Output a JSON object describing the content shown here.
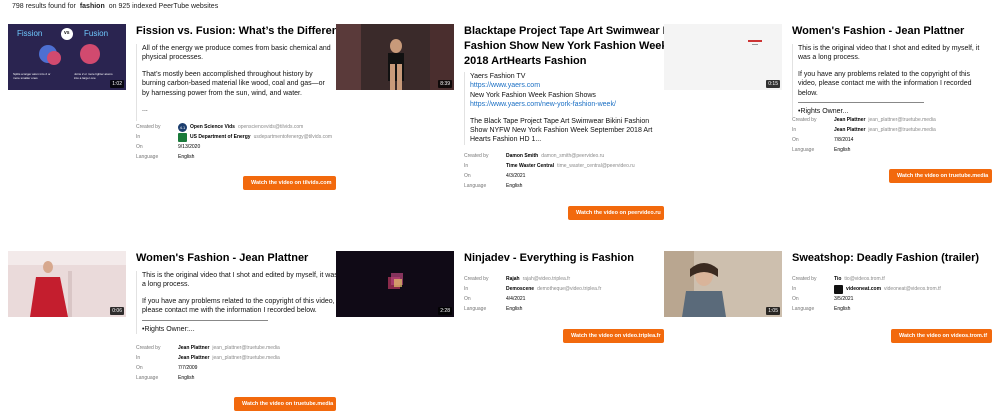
{
  "summary": {
    "count_text": "798 results found for",
    "query": "fashion",
    "indexed_text": "on 925 indexed PeerTube websites"
  },
  "labels": {
    "created_by": "Created by",
    "in": "In",
    "on": "On",
    "language": "Language"
  },
  "results": [
    {
      "title": "Fission vs. Fusion: What’s the Difference?",
      "duration": "1:02",
      "description": [
        "All of the energy we produce comes from basic chemical and physical processes.",
        "That’s mostly been accomplished throughout history by burning carbon-based material like wood, coal and gas—or by harnessing power from the sun, wind, and water.",
        "..."
      ],
      "thumb_text": {
        "left": "Fission",
        "mid": "vs",
        "right": "Fusion",
        "cap_left": "Splits a larger atom into 2 or more smaller ones",
        "cap_right": "Joins 2 or more lighter atoms into a larger one"
      },
      "created_by": "Open Science Vids",
      "created_by_handle": "opensciencevids@tilvids.com",
      "created_badge": "4.1",
      "channel": "US Department of Energy",
      "channel_handle": "usdepartmentofenergy@tilvids.com",
      "date": "9/13/2020",
      "language": "English",
      "button": "Watch the video on tilvids.com"
    },
    {
      "title_lines": [
        "Blacktape Project Tape Art Swimwear Bikini",
        "Fashion Show New York Fashion Week",
        "2018 ArtHearts Fashion"
      ],
      "duration": "8:39",
      "description_html_parts": {
        "p1": "Yaers Fashion TV",
        "link1": "https://www.yaers.com",
        "p2": "New York Fashion Week Fashion Shows",
        "link2": "https://www.yaers.com/new-york-fashion-week/",
        "p3": "The Black Tape Project Tape Art Swimwear Bikini Fashion Show NYFW New York Fashion Week September 2018 Art Hearts Fashion HD 1..."
      },
      "created_by": "Damon Smith",
      "created_by_handle": "damon_smith@peervideo.ru",
      "channel": "Time Waster Central",
      "channel_handle": "time_waster_central@peervideo.ru",
      "date": "4/3/2021",
      "language": "English",
      "button": "Watch the video on peervideo.ru"
    },
    {
      "title": "Women's Fashion - Jean Plattner",
      "duration": "0:15",
      "description": [
        "This is the original video that I shot and edited by myself, it was a long process.",
        "If you have any problems related to the copyright of this video, please contact me with the information I recorded below.",
        "——————————————————",
        "•Rights Owner..."
      ],
      "created_by": "Jean Plattner",
      "created_by_handle": "jean_plattner@truetube.media",
      "channel": "Jean Plattner",
      "channel_handle": "jean_plattner@truetube.media",
      "date": "7/8/2014",
      "language": "English",
      "button": "Watch the video on truetube.media"
    },
    {
      "title": "Women's Fashion - Jean Plattner",
      "duration": "0:06",
      "description": [
        "This is the original video that I shot and edited by myself, it was a long process.",
        "If you have any problems related to the copyright of this video, please contact me with the information I recorded below.",
        "——————————————————",
        "•Rights Owner:..."
      ],
      "created_by": "Jean Plattner",
      "created_by_handle": "jean_plattner@truetube.media",
      "channel": "Jean Plattner",
      "channel_handle": "jean_plattner@truetube.media",
      "date": "7/7/2009",
      "language": "English",
      "button": "Watch the video on truetube.media"
    },
    {
      "title": "Ninjadev - Everything is Fashion",
      "duration": "2:28",
      "created_by": "Rajah",
      "created_by_handle": "rajah@video.triplea.fr",
      "channel": "Demoscene",
      "channel_handle": "demotheque@video.triplea.fr",
      "date": "4/4/2021",
      "language": "English",
      "button": "Watch the video on video.triplea.fr"
    },
    {
      "title": "Sweatshop: Deadly Fashion (trailer)",
      "duration": "1:05",
      "created_by": "Tio",
      "created_by_handle": "tio@videos.trom.tf",
      "channel": "videoneat.com",
      "channel_handle": "videoneat@videos.trom.tf",
      "date": "3/5/2021",
      "language": "English",
      "button": "Watch the video on videos.trom.tf"
    }
  ],
  "colors": {
    "accent": "#f2690d",
    "link": "#1a6fc4"
  }
}
